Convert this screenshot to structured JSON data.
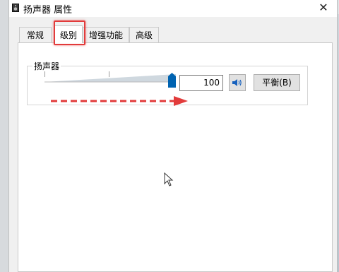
{
  "window": {
    "title": "扬声器 属性",
    "close_glyph": "✕"
  },
  "tabs": [
    {
      "label": "常规",
      "active": false
    },
    {
      "label": "级别",
      "active": true
    },
    {
      "label": "增强功能",
      "active": false
    },
    {
      "label": "高级",
      "active": false
    }
  ],
  "levels": {
    "group_label": "扬声器",
    "volume_value": "100",
    "volume_level_percent": 100,
    "mute_icon": "speaker-volume-icon",
    "balance_label": "平衡(B)"
  },
  "annotations": {
    "highlight_color": "#e23b3b",
    "arrow_color": "#e23b3b"
  },
  "colors": {
    "accent_thumb": "#0063b1"
  }
}
